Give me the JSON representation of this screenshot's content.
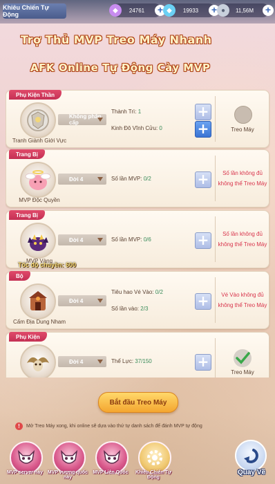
{
  "window": {
    "title": "Khiêu Chiến Tự Động"
  },
  "currencies": [
    {
      "icon": "diamond-pink-icon",
      "value": "24761",
      "color": "#c88cf0"
    },
    {
      "icon": "diamond-blue-icon",
      "value": "19933",
      "color": "#6ad0f4"
    },
    {
      "icon": "coin-silver-icon",
      "value": "11,56M",
      "color": "#c8d0dc"
    }
  ],
  "banner": {
    "line1": "Trợ Thủ MVP Treo Máy Nhanh",
    "line2": "AFK Online Tự Động Cày MVP"
  },
  "cards": [
    {
      "category": "Phụ Kiện Thần",
      "name": "Tranh Giành Giới Vực",
      "dropdown": "Không phân cấp",
      "stats": [
        {
          "label": "Thành Trì:",
          "value": "1"
        },
        {
          "label": "Kinh Đô Vĩnh Cửu:",
          "value": "0"
        }
      ],
      "status": "Treo Máy"
    },
    {
      "category": "Trang Bị",
      "name": "MVP Độc Quyền",
      "dropdown": "Đời 4",
      "stats": [
        {
          "label": "Số lần MVP:",
          "value": "0/2"
        }
      ],
      "status": "Số lần không đủ\nkhông thể Treo Máy"
    },
    {
      "category": "Trang Bị",
      "name": "MVP Vàng",
      "dropdown": "Đời 4",
      "stats": [
        {
          "label": "Số lần MVP:",
          "value": "0/6"
        }
      ],
      "status": "Số lần không đủ\nkhông thể Treo Máy"
    },
    {
      "category": "Bộ",
      "name": "Cấm Địa Dung Nham",
      "dropdown": "Đời 4",
      "stats": [
        {
          "label": "Tiêu hao Vé Vào:",
          "value": "0/2"
        },
        {
          "label": "Số lần vào:",
          "value": "2/3"
        }
      ],
      "status": "Vé Vào không đủ\nkhông thể Treo Máy"
    },
    {
      "category": "Phụ Kiện",
      "name": "",
      "dropdown": "Đời 4",
      "stats": [
        {
          "label": "Thể Lực:",
          "value": "37/150"
        }
      ],
      "status": "Treo Máy"
    }
  ],
  "overlay_text": "Tốc độ chuyền: 600",
  "start_button": "Bắt đầu Treo Máy",
  "info_text": "Mở Treo Máy xong, khi online sẽ dựa vào thứ tự danh sách để đánh MVP tự động",
  "bottom_nav": [
    {
      "label": "MVP server này",
      "icon": "demon-mask-icon"
    },
    {
      "label": "MVP vượng quốc này",
      "icon": "demon-mask-icon"
    },
    {
      "label": "MVP Liên Quốc",
      "icon": "demon-mask-icon"
    },
    {
      "label": "Khiêu Chiến Tự Động",
      "icon": "gear-icon"
    }
  ],
  "back_button": "Quay Về"
}
